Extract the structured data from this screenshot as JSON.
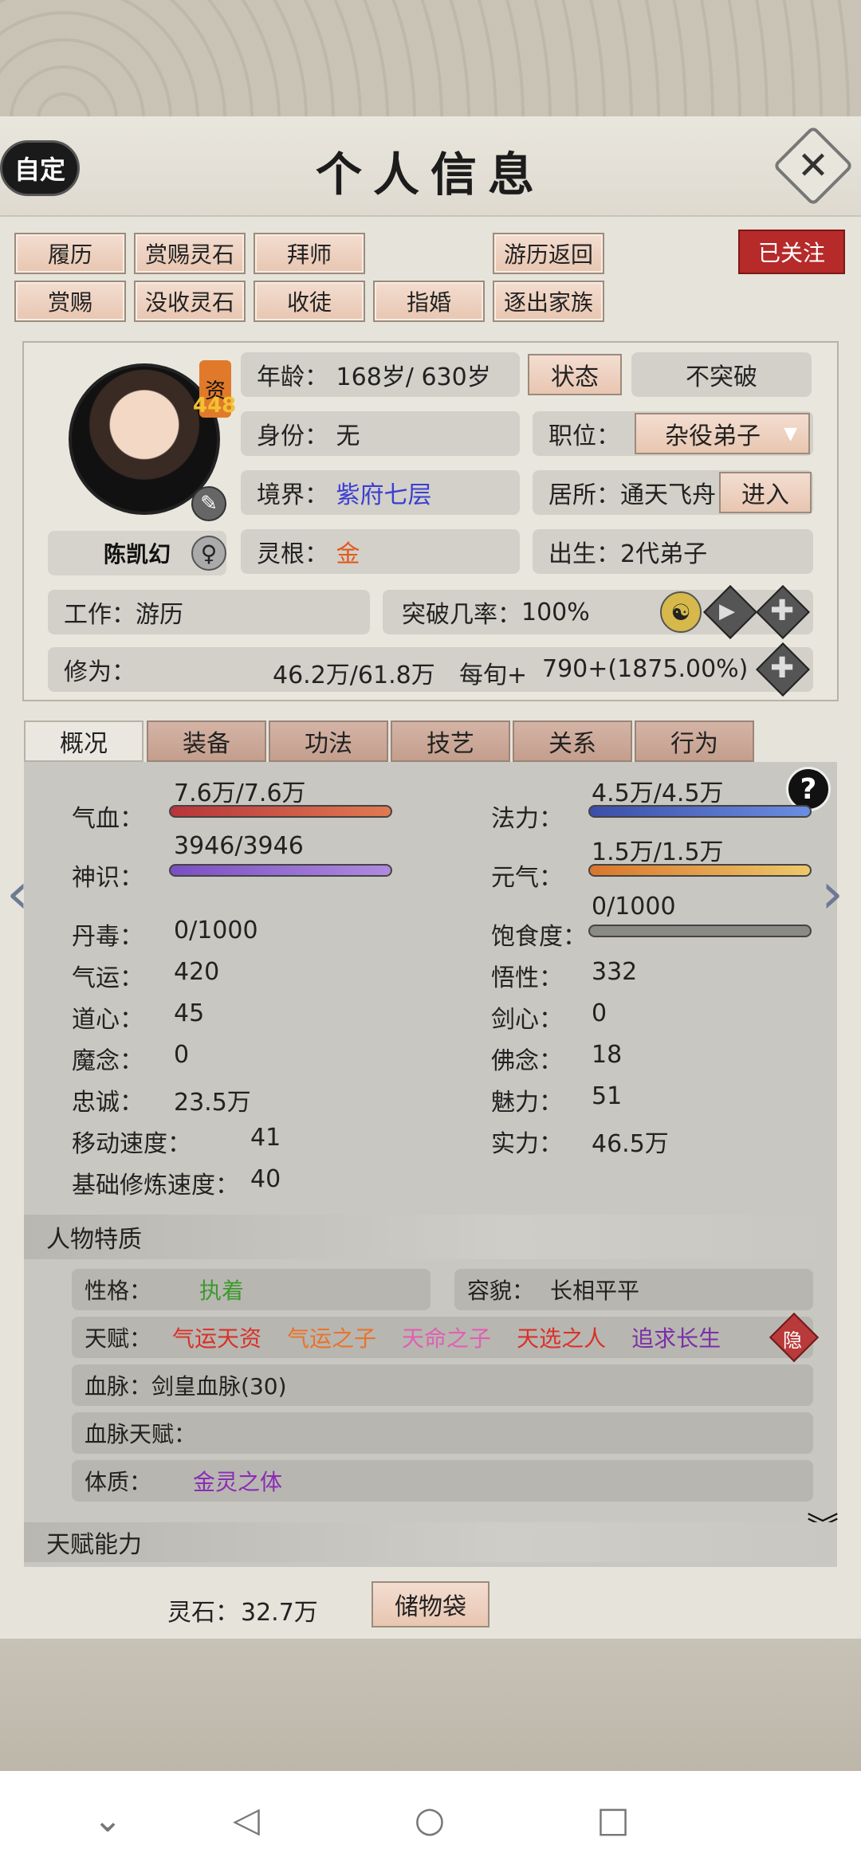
{
  "header": {
    "title": "个人信息",
    "auto_label": "自定",
    "close_icon": "close-icon"
  },
  "actions_row1": [
    "履历",
    "赏赐灵石",
    "拜师",
    "游历返回"
  ],
  "actions_row2": [
    "赏赐",
    "没收灵石",
    "收徒",
    "指婚",
    "逐出家族"
  ],
  "follow_label": "已关注",
  "character": {
    "aptitude_label": "资",
    "aptitude_value": "448",
    "name": "陈凯幻",
    "age_label": "年龄：",
    "age_value": "168岁/ 630岁",
    "state_button": "状态",
    "breakthrough_mode": "不突破",
    "identity_label": "身份：",
    "identity_value": "无",
    "position_label": "职位：",
    "position_value": "杂役弟子",
    "realm_label": "境界：",
    "realm_value": "紫府七层",
    "residence_label": "居所：",
    "residence_value": "通天飞舟",
    "enter_button": "进入",
    "root_label": "灵根：",
    "root_value": "金",
    "birth_label": "出生：",
    "birth_value": "2代弟子",
    "work_label": "工作：",
    "work_value": "游历",
    "break_rate_label": "突破几率：",
    "break_rate_value": "100%",
    "cultivation_label": "修为：",
    "cultivation_value": "46.2万/61.8万",
    "per_period_label": "每旬+",
    "per_period_value": "790+(1875.00%)"
  },
  "tabs": [
    "概况",
    "装备",
    "功法",
    "技艺",
    "关系",
    "行为"
  ],
  "bars": {
    "qixue": {
      "label": "气血：",
      "value": "7.6万/7.6万",
      "fill": 1.0
    },
    "fali": {
      "label": "法力：",
      "value": "4.5万/4.5万",
      "fill": 1.0
    },
    "shenshi": {
      "label": "神识：",
      "value": "3946/3946",
      "fill": 1.0
    },
    "yuanqi": {
      "label": "元气：",
      "value": "1.5万/1.5万",
      "fill": 1.0
    },
    "baoshi": {
      "label": "饱食度：",
      "value": "0/1000",
      "fill": 0.0
    }
  },
  "stats_left": [
    {
      "label": "丹毒：",
      "value": "0/1000"
    },
    {
      "label": "气运：",
      "value": "420"
    },
    {
      "label": "道心：",
      "value": "45"
    },
    {
      "label": "魔念：",
      "value": "0"
    },
    {
      "label": "忠诚：",
      "value": "23.5万"
    },
    {
      "label": "移动速度：",
      "value": "41"
    },
    {
      "label": "基础修炼速度：",
      "value": "40"
    }
  ],
  "stats_right": [
    {
      "label": "悟性：",
      "value": "332"
    },
    {
      "label": "剑心：",
      "value": "0"
    },
    {
      "label": "佛念：",
      "value": "18"
    },
    {
      "label": "魅力：",
      "value": "51"
    },
    {
      "label": "实力：",
      "value": "46.5万"
    }
  ],
  "traits": {
    "section_title": "人物特质",
    "personality_label": "性格：",
    "personality_value": "执着",
    "looks_label": "容貌：",
    "looks_value": "长相平平",
    "talent_label": "天赋：",
    "talents": [
      "气运天资",
      "气运之子",
      "天命之子",
      "天选之人",
      "追求长生"
    ],
    "hide_label": "隐",
    "bloodline_label": "血脉：",
    "bloodline_value": "剑皇血脉(30)",
    "bloodline_talent_label": "血脉天赋：",
    "body_label": "体质：",
    "body_value": "金灵之体"
  },
  "ability_section": "天赋能力",
  "footer": {
    "stone_label": "灵石：",
    "stone_value": "32.7万",
    "bag_button": "储物袋"
  },
  "help_label": "?",
  "colors": {
    "realm": "#3b3fd1",
    "root": "#e05a1e",
    "talent_red": "#d8322b",
    "talent_orange": "#e8742c",
    "talent_pink": "#e05fb3",
    "talent_purple": "#7a2fa8",
    "green": "#3d9a2f",
    "purple": "#8a2db5"
  }
}
